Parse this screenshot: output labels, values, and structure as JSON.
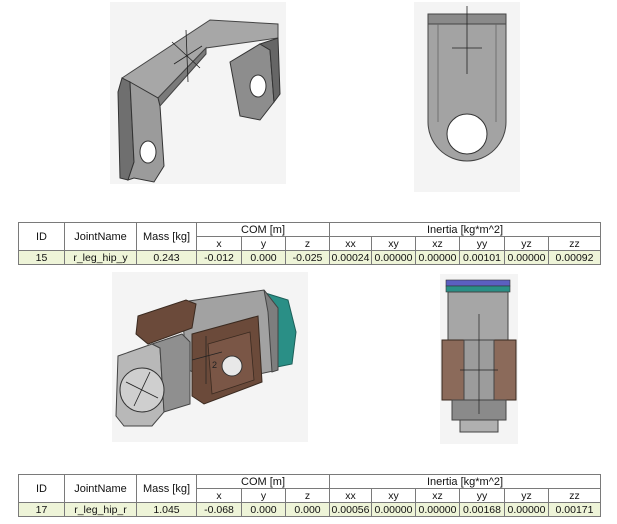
{
  "sections": [
    {
      "headers": {
        "id": "ID",
        "joint_name": "JointName",
        "mass": "Mass [kg]",
        "com": "COM [m]",
        "inertia": "Inertia [kg*m^2]",
        "com_axes": [
          "x",
          "y",
          "z"
        ],
        "inertia_axes": [
          "xx",
          "xy",
          "xz",
          "yy",
          "yz",
          "zz"
        ]
      },
      "row": {
        "id": "15",
        "joint_name": "r_leg_hip_y",
        "mass": "0.243",
        "com": [
          "-0.012",
          "0.000",
          "-0.025"
        ],
        "inertia": [
          "0.00024",
          "0.00000",
          "0.00000",
          "0.00101",
          "0.00000",
          "0.00092"
        ]
      }
    },
    {
      "headers": {
        "id": "ID",
        "joint_name": "JointName",
        "mass": "Mass [kg]",
        "com": "COM [m]",
        "inertia": "Inertia [kg*m^2]",
        "com_axes": [
          "x",
          "y",
          "z"
        ],
        "inertia_axes": [
          "xx",
          "xy",
          "xz",
          "yy",
          "yz",
          "zz"
        ]
      },
      "row": {
        "id": "17",
        "joint_name": "r_leg_hip_r",
        "mass": "1.045",
        "com": [
          "-0.068",
          "0.000",
          "0.000"
        ],
        "inertia": [
          "0.00056",
          "0.00000",
          "0.00000",
          "0.00168",
          "0.00000",
          "0.00171"
        ]
      }
    }
  ],
  "views": {
    "assembly_label": "2"
  },
  "colors": {
    "part_gray": "#9a9a9a",
    "part_dark": "#555555",
    "servo_brown": "#6b4a3a",
    "teal": "#2a8f86",
    "row_highlight": "#eef4d8"
  }
}
